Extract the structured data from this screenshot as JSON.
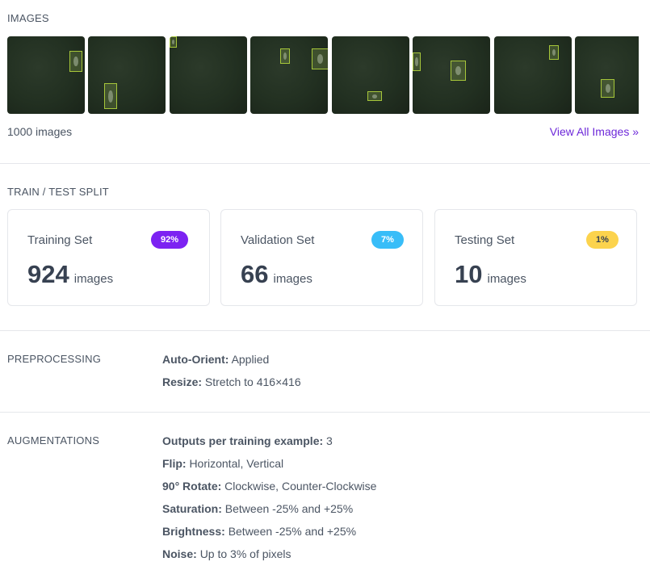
{
  "images": {
    "label": "IMAGES",
    "count": "1000 images",
    "view_all": "View All Images »"
  },
  "split": {
    "label": "TRAIN / TEST SPLIT",
    "cards": [
      {
        "title": "Training Set",
        "badge": "92%",
        "count": "924",
        "unit": "images",
        "badge_color": "#7c22f2",
        "badge_text_color": "#ffffff"
      },
      {
        "title": "Validation Set",
        "badge": "7%",
        "count": "66",
        "unit": "images",
        "badge_color": "#38bdf8",
        "badge_text_color": "#ffffff"
      },
      {
        "title": "Testing Set",
        "badge": "1%",
        "count": "10",
        "unit": "images",
        "badge_color": "#fcd34d",
        "badge_text_color": "#374151"
      }
    ]
  },
  "preprocessing": {
    "label": "PREPROCESSING",
    "items": [
      {
        "key": "Auto-Orient:",
        "value": "Applied"
      },
      {
        "key": "Resize:",
        "value": "Stretch to 416×416"
      }
    ]
  },
  "augmentations": {
    "label": "AUGMENTATIONS",
    "items": [
      {
        "key": "Outputs per training example:",
        "value": "3"
      },
      {
        "key": "Flip:",
        "value": "Horizontal, Vertical"
      },
      {
        "key": "90° Rotate:",
        "value": "Clockwise, Counter-Clockwise"
      },
      {
        "key": "Saturation:",
        "value": "Between -25% and +25%"
      },
      {
        "key": "Brightness:",
        "value": "Between -25% and +25%"
      },
      {
        "key": "Noise:",
        "value": "Up to 3% of pixels"
      }
    ]
  }
}
